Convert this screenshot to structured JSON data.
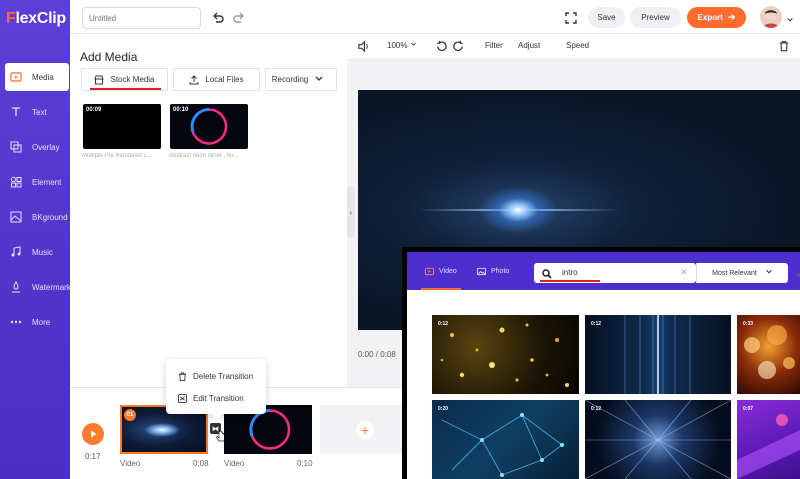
{
  "app": {
    "logo_prefix": "F",
    "logo_rest": "lexClip",
    "title_placeholder": "Untitled"
  },
  "sidebar": {
    "items": [
      {
        "label": "Media",
        "icon": "media-icon"
      },
      {
        "label": "Text",
        "icon": "text-icon"
      },
      {
        "label": "Overlay",
        "icon": "overlay-icon"
      },
      {
        "label": "Element",
        "icon": "element-icon"
      },
      {
        "label": "BKground",
        "icon": "background-icon"
      },
      {
        "label": "Music",
        "icon": "music-icon"
      },
      {
        "label": "Watermark",
        "icon": "watermark-icon"
      },
      {
        "label": "More",
        "icon": "more-icon"
      }
    ]
  },
  "topbar": {
    "save_label": "Save",
    "preview_label": "Preview",
    "export_label": "Export"
  },
  "media_panel": {
    "title": "Add Media",
    "tabs": [
      "Stock Media",
      "Local Files",
      "Recording"
    ],
    "items": [
      {
        "duration": "00:09",
        "caption": "Multiple Pre Rendered L..."
      },
      {
        "duration": "00:10",
        "caption": "Abstract neon circle , flu..."
      }
    ]
  },
  "editor_toolbar": {
    "zoom": "100%",
    "filter": "Filter",
    "adjust": "Adjust",
    "speed": "Speed"
  },
  "player": {
    "time": "0:00 / 0:08"
  },
  "timeline": {
    "total_time": "0:17",
    "clips": [
      {
        "badge": "01",
        "label": "Video",
        "duration": "0:08"
      },
      {
        "label": "Video",
        "duration": "0:10"
      }
    ]
  },
  "context_menu": {
    "delete": "Delete Transition",
    "edit": "Edit Transition"
  },
  "stock_overlay": {
    "tabs": [
      "Video",
      "Photo"
    ],
    "search_value": "intro",
    "sort": "Most Relevant",
    "results": [
      {
        "duration": "0:12"
      },
      {
        "duration": "0:12"
      },
      {
        "duration": "0:33"
      },
      {
        "duration": "0:20"
      },
      {
        "duration": "0:12"
      },
      {
        "duration": "0:07"
      }
    ]
  },
  "colors": {
    "brand_purple": "#5b3fd6",
    "accent_orange": "#ff6b2c",
    "highlight_red": "#e11f25"
  }
}
